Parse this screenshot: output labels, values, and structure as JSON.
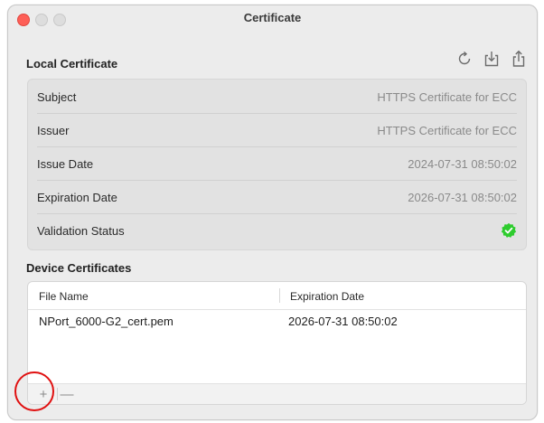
{
  "window": {
    "title": "Certificate"
  },
  "local_certificate": {
    "heading": "Local Certificate",
    "toolbar": {
      "refresh_icon": "refresh-icon",
      "download_icon": "download-icon",
      "share_icon": "share-icon"
    },
    "rows": [
      {
        "label": "Subject",
        "value": "HTTPS Certificate for ECC"
      },
      {
        "label": "Issuer",
        "value": "HTTPS Certificate for ECC"
      },
      {
        "label": "Issue Date",
        "value": "2024-07-31 08:50:02"
      },
      {
        "label": "Expiration Date",
        "value": "2026-07-31 08:50:02"
      },
      {
        "label": "Validation Status",
        "status_icon": "verified-check-icon",
        "status_color": "#2ecc2e"
      }
    ]
  },
  "device_certificates": {
    "heading": "Device Certificates",
    "columns": [
      "File Name",
      "Expiration Date"
    ],
    "rows": [
      {
        "file_name": "NPort_6000-G2_cert.pem",
        "expiration_date": "2026-07-31 08:50:02"
      }
    ],
    "add_label": "+",
    "remove_label": "—"
  },
  "annotation": {
    "highlight_color": "#e01010",
    "highlight_target": "add-certificate-button"
  }
}
